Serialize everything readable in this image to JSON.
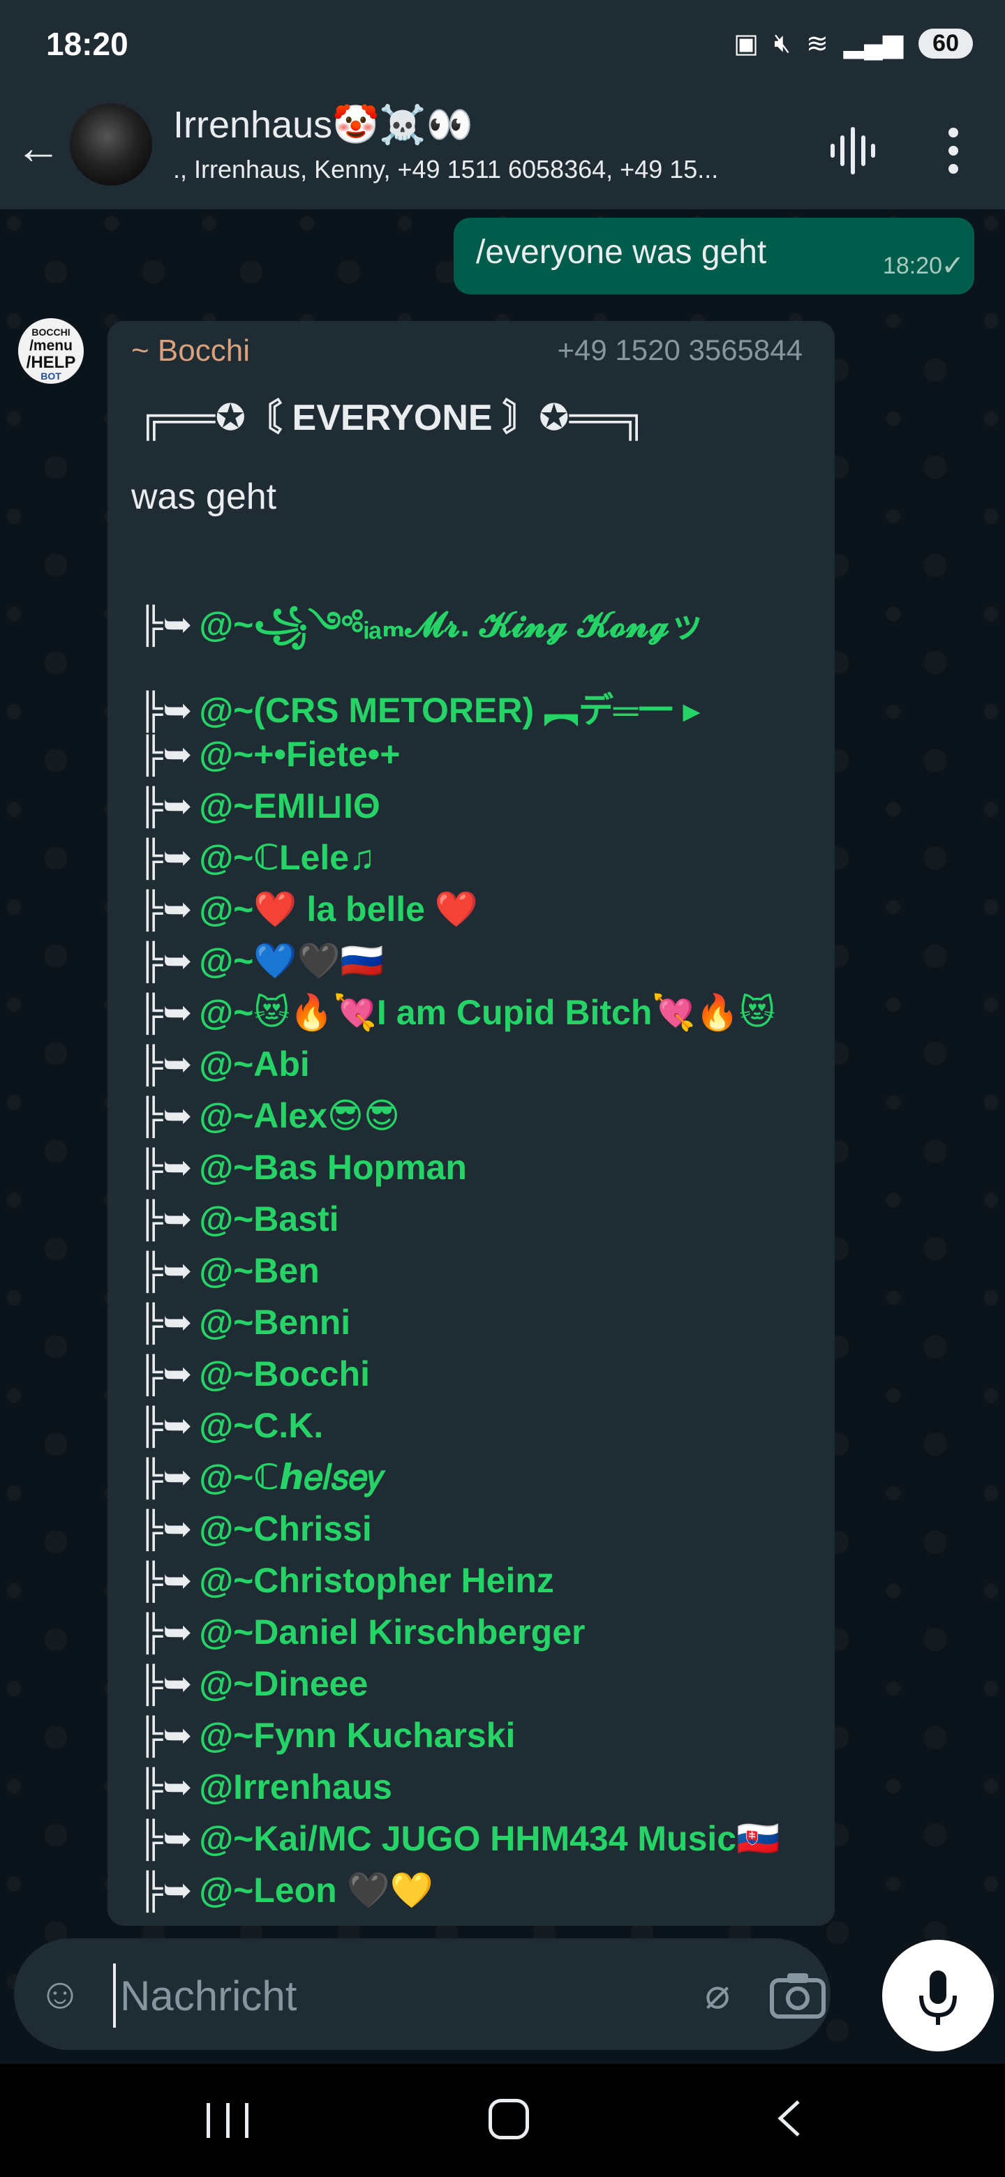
{
  "status_bar": {
    "time": "18:20",
    "battery": "60"
  },
  "header": {
    "title": "Irrenhaus🤡☠️👀",
    "subtitle": "., Irrenhaus, Kenny, +49 1511 6058364, +49 15..."
  },
  "outgoing_message": {
    "text": "/everyone was geht",
    "time": "18:20"
  },
  "bot_avatar": {
    "line1": "BOCCHI",
    "line2": "/menu",
    "line3": "/HELP",
    "line4": "BOT"
  },
  "incoming_message": {
    "sender": "~ Bocchi",
    "phone": "+49 1520 3565844",
    "banner": "╔══✪〘 EVERYONE 〙✪══╗",
    "text": "was geht",
    "pipe": "╠➥",
    "mentions": [
      "@~꧁༺ᵢₐₘ𝓜𝓻. 𝓚𝓲𝓷𝓰 𝓚𝓸𝓷𝓰ッ",
      "@~(CRS METORER) ︻デ═一 ▸",
      "@~+•Fiete•+",
      "@~EMI⊔IΘ",
      "@~ℂLele♫",
      "@~❤️ la belle ❤️",
      "@~💙🖤🇷🇺",
      "@~😻🔥💘I am Cupid Bitch💘🔥😻",
      "@~Abi",
      "@~Alex😎😎",
      "@~Bas Hopman",
      "@~Basti",
      "@~Ben",
      "@~Benni",
      "@~Bocchi",
      "@~C.K.",
      "@~ℂℎ𝑒𝑙𝑠𝑒𝑦",
      "@~Chrissi",
      "@~Christopher Heinz",
      "@~Daniel Kirschberger",
      "@~Dineee",
      "@~Fynn Kucharski",
      "@Irrenhaus",
      "@~Kai/MC JUGO HHM434 Music🇸🇰",
      "@~Leon 🖤💛"
    ]
  },
  "composer": {
    "placeholder": "Nachricht"
  }
}
